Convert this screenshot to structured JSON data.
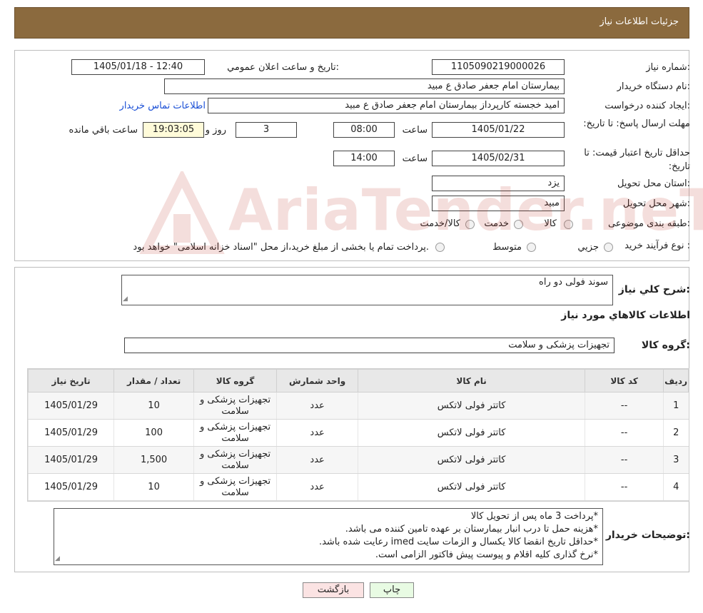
{
  "header": {
    "title": "جزئیات اطلاعات نیاز"
  },
  "form": {
    "need_number_label": "شماره نیاز:",
    "need_number": "1105090219000026",
    "announce_label": "تاریخ و ساعت اعلان عمومي:",
    "announce_value": "1405/01/18 - 12:40",
    "buyer_org_label": "نام دستگاه خریدار:",
    "buyer_org": "بیمارستان امام جعفر صادق  ع  مبید",
    "creator_label": "ایجاد کننده درخواست:",
    "creator": "امید خجسته کارپرداز بیمارستان امام جعفر صادق  ع  مبید",
    "contact_link": "اطلاعات تماس خریدار",
    "deadline_label": "مهلت ارسال پاسخ: تا تاریخ:",
    "deadline_date": "1405/01/22",
    "time_label": "ساعت",
    "deadline_time": "08:00",
    "days_value": "3",
    "days_label": "روز و",
    "countdown": "19:03:05",
    "remaining_label": "ساعت باقي مانده",
    "validity_label": "حداقل تاریخ اعتبار قیمت: تا تاریخ:",
    "validity_date": "1405/02/31",
    "validity_time": "14:00",
    "province_label": "استان محل تحویل:",
    "province": "یزد",
    "city_label": "شهر محل تحویل:",
    "city": "مبید",
    "category_label": "طبقه بندی موضوعی:",
    "category_options": [
      "کالا",
      "خدمت",
      "کالا/خدمت"
    ],
    "process_label": "نوع فرآیند خرید :",
    "process_options": [
      "جزیي",
      "متوسط"
    ],
    "process_note": "پرداخت تمام یا بخشی از مبلغ خرید،از محل \"اسناد خزانه اسلامی\" خواهد بود."
  },
  "description": {
    "label": "شرح كلي نياز:",
    "value": "سوند فولی دو راه"
  },
  "goods_section_title": "اطلاعات كالاهاي مورد نياز",
  "goods_group": {
    "label": "گروه کالا:",
    "value": "تجهیزات پزشکی و سلامت"
  },
  "table": {
    "headers": [
      "ردیف",
      "کد کالا",
      "نام کالا",
      "واحد شمارش",
      "گروه کالا",
      "تعداد / مقدار",
      "تاریخ نیاز"
    ],
    "rows": [
      {
        "row": "1",
        "code": "--",
        "name": "کاتتر فولی لاتکس",
        "unit": "عدد",
        "group": "تجهیزات پزشکی و سلامت",
        "qty": "10",
        "date": "1405/01/29"
      },
      {
        "row": "2",
        "code": "--",
        "name": "کاتتر فولی لاتکس",
        "unit": "عدد",
        "group": "تجهیزات پزشکی و سلامت",
        "qty": "100",
        "date": "1405/01/29"
      },
      {
        "row": "3",
        "code": "--",
        "name": "کاتتر فولی لاتکس",
        "unit": "عدد",
        "group": "تجهیزات پزشکی و سلامت",
        "qty": "1,500",
        "date": "1405/01/29"
      },
      {
        "row": "4",
        "code": "--",
        "name": "کاتتر فولی لاتکس",
        "unit": "عدد",
        "group": "تجهیزات پزشکی و سلامت",
        "qty": "10",
        "date": "1405/01/29"
      }
    ]
  },
  "buyer_notes": {
    "label": "توضیحات خریدار:",
    "lines": [
      "*پرداخت 3 ماه پس از تحویل کالا",
      "*هزینه حمل تا درب انبار بیمارستان بر عهده تامین کننده می باشد.",
      "*حداقل تاریخ انقضا کالا یکسال و الزمات سایت imed رعایت شده باشد.",
      "*نرخ گذاری کلیه اقلام و پیوست پیش فاکتور الزامی است."
    ]
  },
  "buttons": {
    "print": "چاپ",
    "back": "بازگشت"
  },
  "watermark": {
    "text": "AriaTender.neT"
  },
  "colors": {
    "header_bg": "#8b6a3e",
    "link": "#1a4fd6",
    "back_button": "#fbe3e3",
    "print_button": "#e8fbe3"
  }
}
